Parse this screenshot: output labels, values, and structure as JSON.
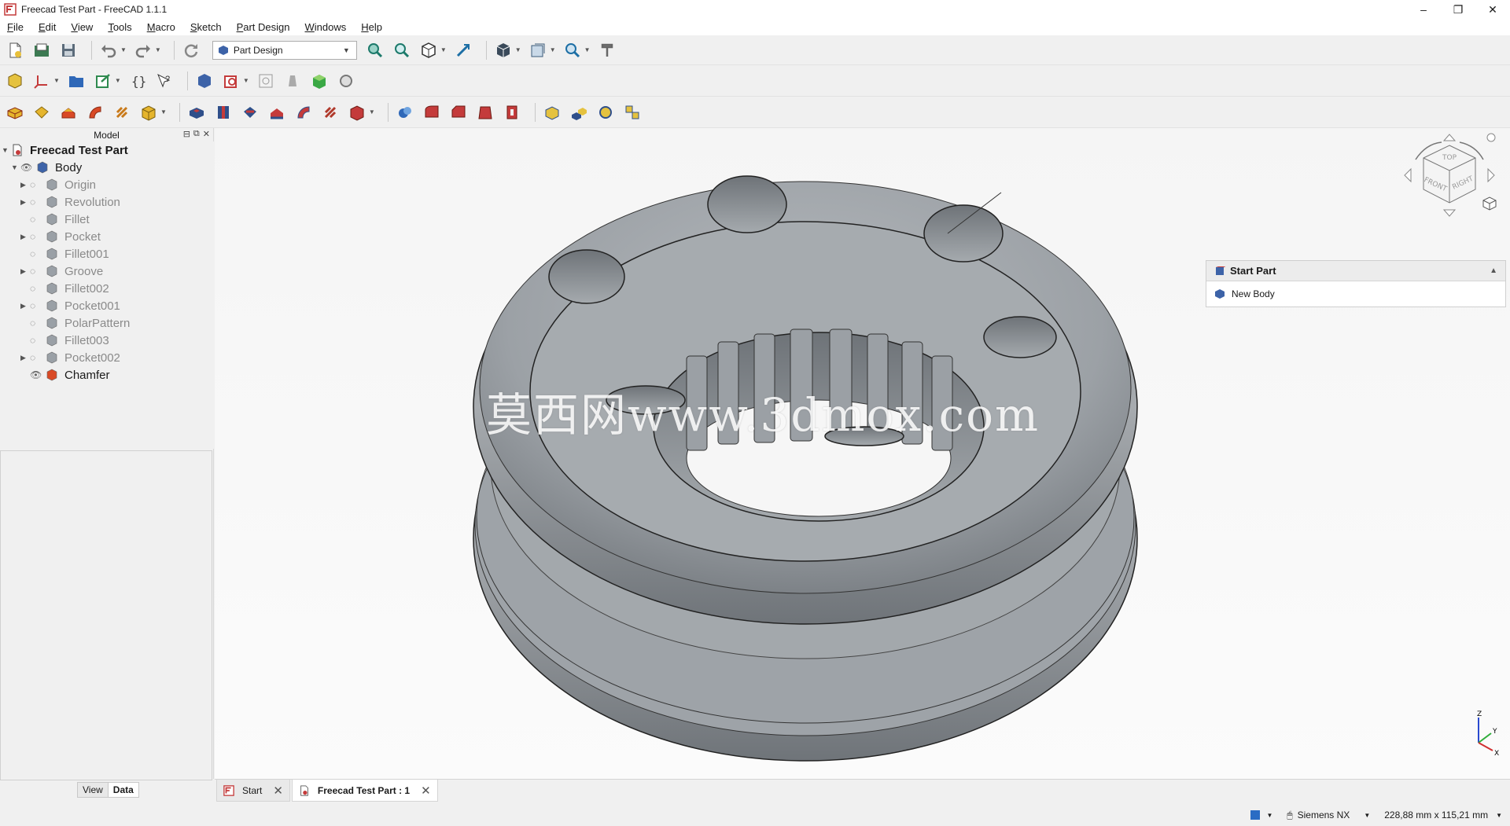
{
  "window": {
    "title": "Freecad Test Part - FreeCAD 1.1.1",
    "minimize": "–",
    "maximize": "❐",
    "close": "✕"
  },
  "menu": [
    "File",
    "Edit",
    "View",
    "Tools",
    "Macro",
    "Sketch",
    "Part Design",
    "Windows",
    "Help"
  ],
  "toolbar": {
    "workbench": "Part Design"
  },
  "model_panel": {
    "title": "Model",
    "tree": [
      {
        "label": "Freecad Test Part",
        "level": 0,
        "expanded": true,
        "visible": true,
        "bold": true,
        "dim": false
      },
      {
        "label": "Body",
        "level": 1,
        "expanded": true,
        "visible": true,
        "bold": false,
        "dim": false
      },
      {
        "label": "Origin",
        "level": 2,
        "expandable": true,
        "visible": false,
        "dim": true
      },
      {
        "label": "Revolution",
        "level": 2,
        "expandable": true,
        "visible": false,
        "dim": true
      },
      {
        "label": "Fillet",
        "level": 2,
        "expandable": false,
        "visible": false,
        "dim": true
      },
      {
        "label": "Pocket",
        "level": 2,
        "expandable": true,
        "visible": false,
        "dim": true
      },
      {
        "label": "Fillet001",
        "level": 2,
        "expandable": false,
        "visible": false,
        "dim": true
      },
      {
        "label": "Groove",
        "level": 2,
        "expandable": true,
        "visible": false,
        "dim": true
      },
      {
        "label": "Fillet002",
        "level": 2,
        "expandable": false,
        "visible": false,
        "dim": true
      },
      {
        "label": "Pocket001",
        "level": 2,
        "expandable": true,
        "visible": false,
        "dim": true
      },
      {
        "label": "PolarPattern",
        "level": 2,
        "expandable": false,
        "visible": false,
        "dim": true
      },
      {
        "label": "Fillet003",
        "level": 2,
        "expandable": false,
        "visible": false,
        "dim": true
      },
      {
        "label": "Pocket002",
        "level": 2,
        "expandable": true,
        "visible": false,
        "dim": true
      },
      {
        "label": "Chamfer",
        "level": 2,
        "expandable": false,
        "visible": true,
        "dim": false
      }
    ],
    "tabs": [
      "View",
      "Data"
    ],
    "active_tab": "Data"
  },
  "viewport": {
    "watermark": "莫西网www.3dmox.com",
    "navcube_faces": [
      "TOP",
      "FRONT",
      "RIGHT"
    ],
    "axis_labels": [
      "Z",
      "Y",
      "X"
    ]
  },
  "task_panel": {
    "title": "Start Part",
    "action": "New Body"
  },
  "doc_tabs": [
    {
      "label": "Start",
      "active": false
    },
    {
      "label": "Freecad Test Part : 1",
      "active": true
    }
  ],
  "status": {
    "navigation": "Siemens NX",
    "dimensions": "228,88 mm x 115,21 mm"
  },
  "colors": {
    "accent": "#2a6cc4",
    "part_gray": "#9aa0a6"
  }
}
